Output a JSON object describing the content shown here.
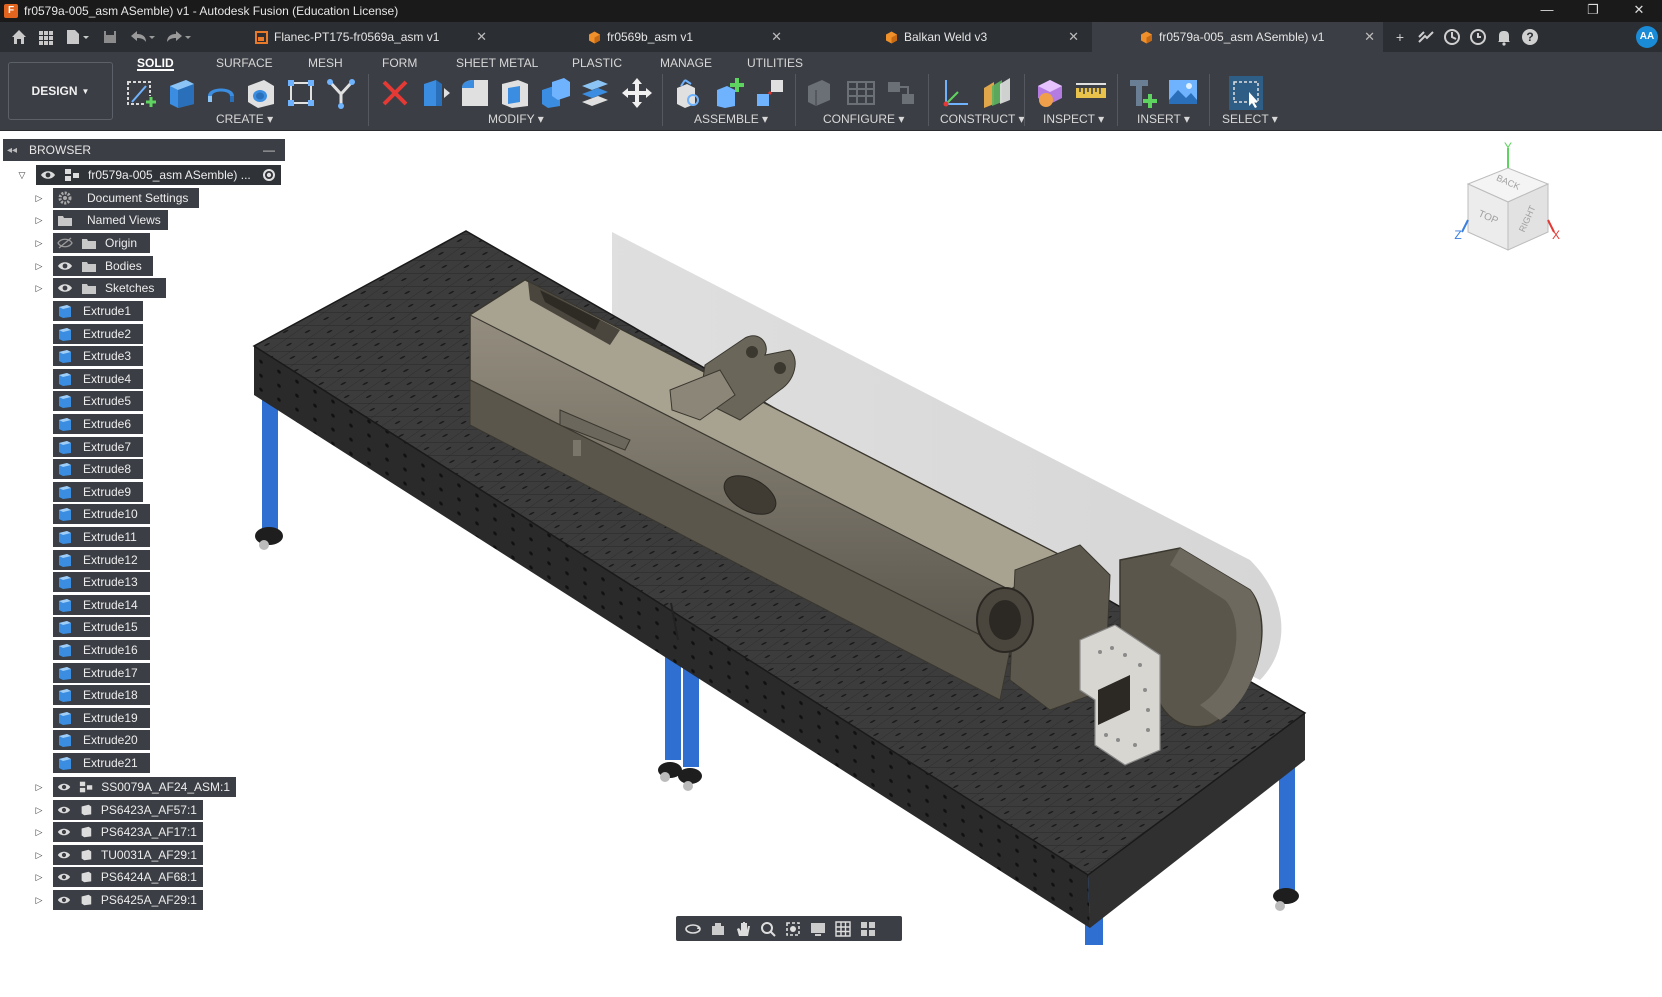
{
  "window": {
    "title": "fr0579a-005_asm ASemble) v1 - Autodesk Fusion (Education License)",
    "app_icon": "F",
    "controls": [
      "—",
      "❐",
      "✕"
    ]
  },
  "tabs": [
    {
      "label": "Flanec-PT175-fr0569a_asm v1",
      "icon": "drawing-icon",
      "close": "✕",
      "active": false
    },
    {
      "label": "fr0569b_asm v1",
      "icon": "assembly-icon",
      "close": "✕",
      "active": false
    },
    {
      "label": "Balkan Weld v3",
      "icon": "assembly-icon",
      "close": "✕",
      "active": false
    },
    {
      "label": "fr0579a-005_asm ASemble) v1",
      "icon": "assembly-icon",
      "close": "✕",
      "active": true
    }
  ],
  "user": {
    "initials": "AA"
  },
  "toolbar": {
    "workspace": "DESIGN",
    "workspace_tabs": [
      "SOLID",
      "SURFACE",
      "MESH",
      "FORM",
      "SHEET METAL",
      "PLASTIC",
      "MANAGE",
      "UTILITIES"
    ],
    "active_tab": "SOLID",
    "groups": [
      "CREATE",
      "MODIFY",
      "ASSEMBLE",
      "CONFIGURE",
      "CONSTRUCT",
      "INSPECT",
      "INSERT",
      "SELECT"
    ]
  },
  "browser": {
    "title": "BROWSER",
    "collapse": "—",
    "root": "fr0579a-005_asm ASemble) ...",
    "folders": [
      "Document Settings",
      "Named Views",
      "Origin",
      "Bodies",
      "Sketches"
    ],
    "features": [
      "Extrude1",
      "Extrude2",
      "Extrude3",
      "Extrude4",
      "Extrude5",
      "Extrude6",
      "Extrude7",
      "Extrude8",
      "Extrude9",
      "Extrude10",
      "Extrude11",
      "Extrude12",
      "Extrude13",
      "Extrude14",
      "Extrude15",
      "Extrude16",
      "Extrude17",
      "Extrude18",
      "Extrude19",
      "Extrude20",
      "Extrude21"
    ],
    "components": [
      "SS0079A_AF24_ASM:1",
      "PS6423A_AF57:1",
      "PS6423A_AF17:1",
      "TU0031A_AF29:1",
      "PS6424A_AF68:1",
      "PS6425A_AF29:1"
    ]
  },
  "viewcube": {
    "back": "BACK",
    "top": "TOP",
    "right": "RIGHT",
    "axis_x": "X",
    "axis_y": "Y",
    "axis_z": "Z"
  }
}
